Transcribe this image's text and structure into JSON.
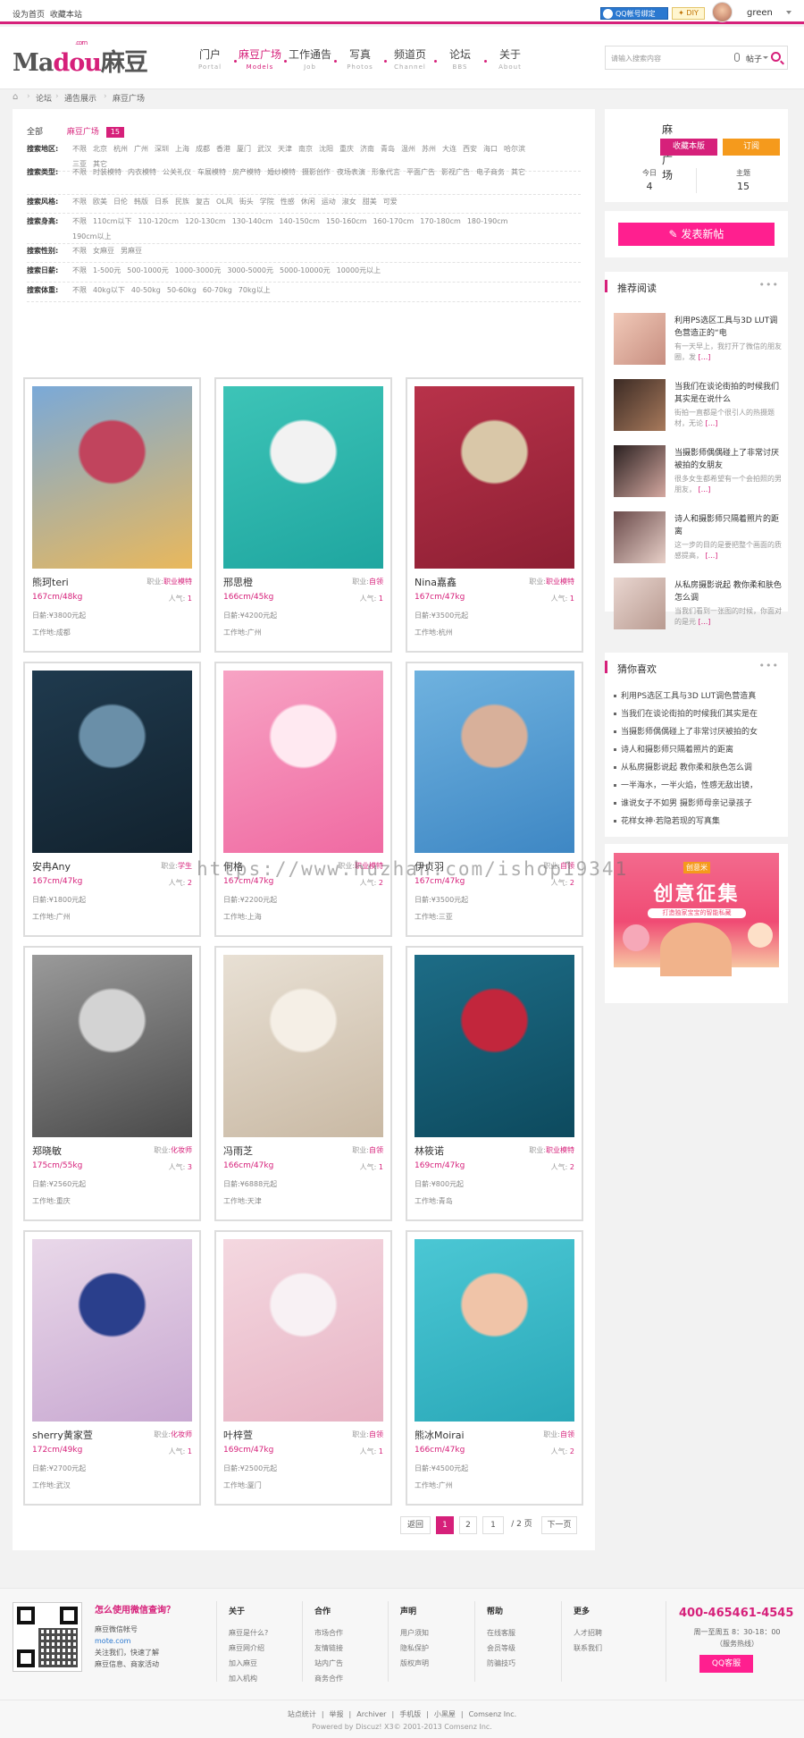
{
  "topbar": {
    "set_home": "设为首页",
    "bookmark": "收藏本站",
    "qq_bind": "QQ帐号绑定",
    "diy": "DIY",
    "username": "green"
  },
  "logo": {
    "text1": "Ma",
    "text2": "dou",
    "text3": "麻豆",
    "small": ".com"
  },
  "nav": [
    {
      "t": "门户",
      "s": "Portal",
      "active": false
    },
    {
      "t": "麻豆广场",
      "s": "Models",
      "active": true
    },
    {
      "t": "工作通告",
      "s": "Job",
      "active": false
    },
    {
      "t": "写真",
      "s": "Photos",
      "active": false
    },
    {
      "t": "频道页",
      "s": "Channel",
      "active": false
    },
    {
      "t": "论坛",
      "s": "BBS",
      "active": false
    },
    {
      "t": "关于",
      "s": "About",
      "active": false
    }
  ],
  "search": {
    "placeholder": "请输入搜索内容",
    "category": "帖子"
  },
  "breadcrumb": [
    "论坛",
    "通告展示",
    "麻豆广场"
  ],
  "filters": {
    "all": "全部",
    "current": "麻豆广场",
    "count": "15",
    "rows": [
      {
        "label": "搜索地区:",
        "opts": [
          "不限",
          "北京",
          "杭州",
          "广州",
          "深圳",
          "上海",
          "成都",
          "香港",
          "厦门",
          "武汉",
          "天津",
          "南京",
          "沈阳",
          "重庆",
          "济南",
          "青岛",
          "温州",
          "苏州",
          "大连",
          "西安",
          "海口",
          "哈尔滨",
          "三亚",
          "其它"
        ]
      },
      {
        "label": "搜索类型:",
        "opts": [
          "不限",
          "时装模特",
          "内衣模特",
          "公关礼仪",
          "车展模特",
          "房产模特",
          "婚纱模特",
          "摄影创作",
          "夜场表演",
          "形象代言",
          "平面广告",
          "影视广告",
          "电子商务",
          "其它"
        ]
      },
      {
        "label": "搜索风格:",
        "opts": [
          "不限",
          "欧美",
          "日伦",
          "韩版",
          "日系",
          "民族",
          "复古",
          "OL风",
          "街头",
          "学院",
          "性感",
          "休闲",
          "运动",
          "淑女",
          "甜美",
          "可爱"
        ]
      },
      {
        "label": "搜索身高:",
        "opts": [
          "不限",
          "110cm以下",
          "110-120cm",
          "120-130cm",
          "130-140cm",
          "140-150cm",
          "150-160cm",
          "160-170cm",
          "170-180cm",
          "180-190cm",
          "190cm以上"
        ]
      },
      {
        "label": "搜索性别:",
        "opts": [
          "不限",
          "女麻豆",
          "男麻豆"
        ]
      },
      {
        "label": "搜索日薪:",
        "opts": [
          "不限",
          "1-500元",
          "500-1000元",
          "1000-3000元",
          "3000-5000元",
          "5000-10000元",
          "10000元以上"
        ]
      },
      {
        "label": "搜索体重:",
        "opts": [
          "不限",
          "40kg以下",
          "40-50kg",
          "50-60kg",
          "60-70kg",
          "70kg以上"
        ]
      }
    ]
  },
  "labels": {
    "job": "职业:",
    "pop": "人气:",
    "price": "日薪:",
    "loc": "工作地:"
  },
  "cards": [
    {
      "name": "熊珂teri",
      "job": "职业模特",
      "hw": "167cm/48kg",
      "pop": "1",
      "price": "¥3800元起",
      "loc": "成都",
      "colors": [
        "#7aa9d8",
        "#e9b85c",
        "#c1445d"
      ]
    },
    {
      "name": "邢思橙",
      "job": "自领",
      "hw": "166cm/45kg",
      "pop": "1",
      "price": "¥4200元起",
      "loc": "广州",
      "colors": [
        "#3dc4b7",
        "#1fa6a0",
        "#f2f2f2"
      ]
    },
    {
      "name": "Nina嘉鑫",
      "job": "职业模特",
      "hw": "167cm/47kg",
      "pop": "1",
      "price": "¥3500元起",
      "loc": "杭州",
      "colors": [
        "#b8324a",
        "#8d1f33",
        "#d9c7a8"
      ]
    },
    {
      "name": "安冉Any",
      "job": "学生",
      "hw": "167cm/47kg",
      "pop": "2",
      "price": "¥1800元起",
      "loc": "广州",
      "colors": [
        "#1f3a4e",
        "#12222e",
        "#6a8fa8"
      ]
    },
    {
      "name": "何格",
      "job": "职业模特",
      "hw": "167cm/47kg",
      "pop": "2",
      "price": "¥2200元起",
      "loc": "上海",
      "colors": [
        "#f7a3c4",
        "#f06aa2",
        "#ffe9f1"
      ]
    },
    {
      "name": "伊贞羽",
      "job": "自领",
      "hw": "167cm/47kg",
      "pop": "2",
      "price": "¥3500元起",
      "loc": "三亚",
      "colors": [
        "#6fb2df",
        "#3e87c4",
        "#d8b09a"
      ]
    },
    {
      "name": "郑晓敏",
      "job": "化妆师",
      "hw": "175cm/55kg",
      "pop": "3",
      "price": "¥2560元起",
      "loc": "重庆",
      "colors": [
        "#9a9a9a",
        "#4a4a4a",
        "#d3d3d3"
      ]
    },
    {
      "name": "冯雨芝",
      "job": "自领",
      "hw": "166cm/47kg",
      "pop": "1",
      "price": "¥6888元起",
      "loc": "天津",
      "colors": [
        "#e8e0d4",
        "#c9b9a4",
        "#f5efe6"
      ]
    },
    {
      "name": "林筱诺",
      "job": "职业模特",
      "hw": "169cm/47kg",
      "pop": "2",
      "price": "¥800元起",
      "loc": "青岛",
      "colors": [
        "#1d6c86",
        "#0d4a5e",
        "#c2263c"
      ]
    },
    {
      "name": "sherry黄家萱",
      "job": "化妆师",
      "hw": "172cm/49kg",
      "pop": "1",
      "price": "¥2700元起",
      "loc": "武汉",
      "colors": [
        "#e9d8e9",
        "#c8a8d1",
        "#2a3f8c"
      ]
    },
    {
      "name": "叶梓萱",
      "job": "自领",
      "hw": "169cm/47kg",
      "pop": "1",
      "price": "¥2500元起",
      "loc": "厦门",
      "colors": [
        "#f4d8e0",
        "#e7b3c4",
        "#f8f1f4"
      ]
    },
    {
      "name": "熊冰Moirai",
      "job": "自领",
      "hw": "166cm/47kg",
      "pop": "2",
      "price": "¥4500元起",
      "loc": "广州",
      "colors": [
        "#4bc7d4",
        "#2aa8b8",
        "#f0c4a8"
      ]
    }
  ],
  "pager": {
    "back": "返回",
    "p1": "1",
    "p2": "2",
    "input": "1",
    "total": "/ 2 页",
    "next": "下一页"
  },
  "side": {
    "fav": {
      "title": "麻豆广场",
      "collect": "收藏本版",
      "subscribe": "订阅",
      "today_label": "今日",
      "today": "4",
      "topics_label": "主题",
      "topics": "15"
    },
    "post": "发表新帖",
    "recommend": {
      "title": "推荐阅读",
      "more": "•••",
      "items": [
        {
          "t": "利用PS选区工具与3D LUT调色营造正的“电",
          "d": "有一天早上，我打开了微信的朋友圈，发",
          "c": [
            "#f1c9b8",
            "#c78e80"
          ]
        },
        {
          "t": "当我们在谈论街拍的时候我们其实是在说什么",
          "d": "街拍一直都是个很引人的热摄题材，无论",
          "c": [
            "#3b2a24",
            "#a87a5c"
          ]
        },
        {
          "t": "当摄影师偶偶碰上了非常讨厌被拍的女朋友",
          "d": "很多女生都希望有一个会拍照的男朋友，",
          "c": [
            "#2a2020",
            "#d4a8a0"
          ]
        },
        {
          "t": "诗人和摄影师只隔着照片的距离",
          "d": "这一步的目的是要把整个画面的质感提高，",
          "c": [
            "#6a4a4a",
            "#e8d0c8"
          ]
        },
        {
          "t": "从私房摄影说起 教你柔和肤色怎么调",
          "d": "当我们看到一张图的时候，你面对的是元",
          "c": [
            "#e9d6d0",
            "#b89a90"
          ]
        }
      ]
    },
    "guess": {
      "title": "猜你喜欢",
      "more": "•••",
      "items": [
        "利用PS选区工具与3D LUT调色营造真",
        "当我们在谈论街拍的时候我们其实是在",
        "当摄影师偶偶碰上了非常讨厌被拍的女",
        "诗人和摄影师只隔着照片的距离",
        "从私房摄影说起 教你柔和肤色怎么调",
        "一半海水，一半火焰，性感无敌出镜，",
        "谁说女子不如男 摄影师母亲记录孩子",
        "花样女神·若隐若现的写真集"
      ]
    },
    "ad": {
      "logo": "创意米",
      "big": "创意征集",
      "sub": "打造独家宝宝的智能私藏"
    }
  },
  "watermark": "https://www.huzhan.com/ishop19341",
  "footer": {
    "wx_title": "怎么使用微信查询？",
    "wx1": "麻豆微信帐号",
    "wx2": "mote.com",
    "wx3": "关注我们，快速了解",
    "wx4": "麻豆信息、商家活动",
    "cols": [
      {
        "h": "关于",
        "l": [
          "麻豆是什么?",
          "麻豆网介绍",
          "加入麻豆",
          "加入机构"
        ]
      },
      {
        "h": "合作",
        "l": [
          "市场合作",
          "友情链接",
          "站内广告",
          "商务合作"
        ]
      },
      {
        "h": "声明",
        "l": [
          "用户须知",
          "隐私保护",
          "版权声明"
        ]
      },
      {
        "h": "帮助",
        "l": [
          "在线客服",
          "会员等级",
          "防骗技巧"
        ]
      },
      {
        "h": "更多",
        "l": [
          "人才招聘",
          "联系我们"
        ]
      }
    ],
    "tel": "400-465461-4545",
    "tel2": "周一至周五 8：30-18：00",
    "tel3": "（服务热线）",
    "qq": "QQ客服",
    "links": [
      "站点统计",
      "举报",
      "Archiver",
      "手机版",
      "小黑屋",
      "Comsenz Inc."
    ],
    "powered": "Powered by Discuz! X3© 2001-2013 Comsenz Inc."
  }
}
